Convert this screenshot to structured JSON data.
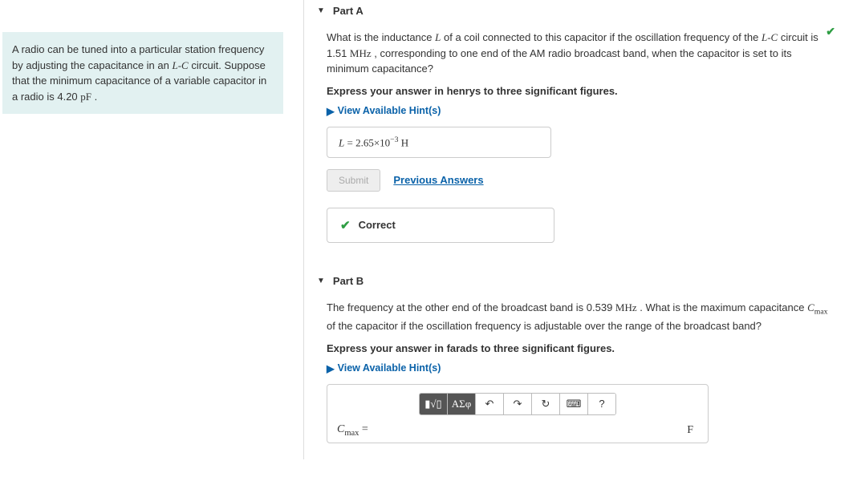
{
  "sidebar": {
    "intro": "A radio can be tuned into a particular station frequency by adjusting the capacitance in an ",
    "lc": "L-C",
    "intro2": " circuit. Suppose that the minimum capacitance of a variable capacitor in a radio is 4.20 ",
    "unit": "pF",
    "intro3": " ."
  },
  "partA": {
    "header": "Part A",
    "q1": "What is the inductance ",
    "sym_L": "L",
    "q2": " of a coil connected to this capacitor if the oscillation frequency of the ",
    "lc": "L-C",
    "q3": " circuit is 1.51 ",
    "freq_unit": "MHz",
    "q4": " , corresponding to one end of the AM radio broadcast band, when the capacitor is set to its minimum capacitance?",
    "instruction": "Express your answer in henrys to three significant figures.",
    "hints": "View Available Hint(s)",
    "answer_lhs": "L",
    "answer_eq": " = ",
    "answer_val": "2.65×10",
    "answer_exp": "−3",
    "answer_unit": "  H",
    "submit": "Submit",
    "prev": "Previous Answers",
    "feedback": "Correct"
  },
  "partB": {
    "header": "Part B",
    "q1": "The frequency at the other end of the broadcast band is 0.539 ",
    "freq_unit": "MHz",
    "q2": " . What is the maximum capacitance ",
    "cmax": "C",
    "cmax_sub": "max",
    "q3": " of the capacitor if the oscillation frequency is adjustable over the range of the broadcast band?",
    "instruction": "Express your answer in farads to three significant figures.",
    "hints": "View Available Hint(s)",
    "lhs_var": "C",
    "lhs_sub": "max",
    "lhs_eq": " =",
    "unit": "F",
    "toolbar": {
      "t1": "▮√▯",
      "t2": "ΑΣφ",
      "undo": "↶",
      "redo": "↷",
      "reset": "↻",
      "keyboard": "⌨",
      "help": "?"
    }
  }
}
